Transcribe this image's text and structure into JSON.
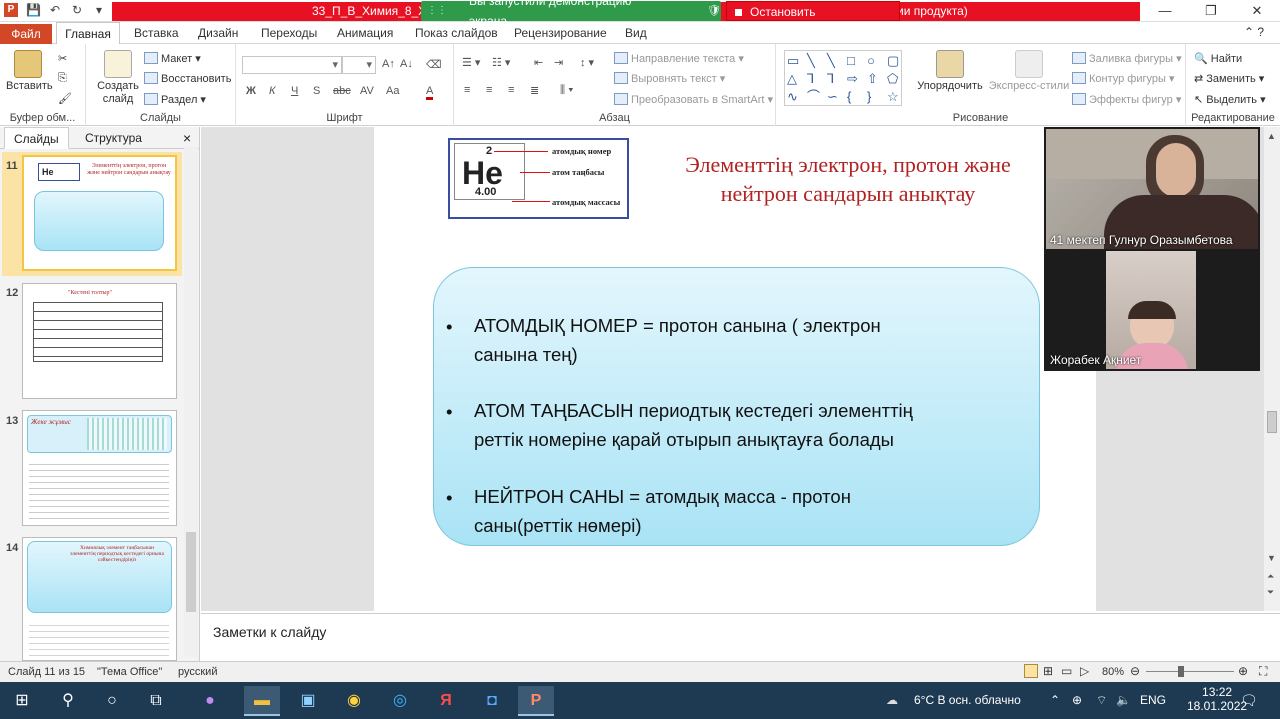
{
  "window": {
    "title_prefix": "33_П_В_Химия_8_Хим",
    "title_suffix": "ии продукта)",
    "controls": [
      "—",
      "❐",
      "✕"
    ]
  },
  "share_bar": {
    "message": "Вы запустили демонстрацию экрана",
    "stop_label": "Остановить демонстрацию",
    "colors": {
      "green": "#2e9a4a",
      "red": "#e81123"
    }
  },
  "ribbon_tabs": [
    "Файл",
    "Главная",
    "Вставка",
    "Дизайн",
    "Переходы",
    "Анимация",
    "Показ слайдов",
    "Рецензирование",
    "Вид"
  ],
  "ribbon": {
    "clipboard": {
      "paste": "Вставить",
      "label": "Буфер обм..."
    },
    "slides": {
      "new_slide_1": "Создать",
      "new_slide_2": "слайд",
      "layout": "Макет",
      "reset": "Восстановить",
      "section": "Раздел",
      "label": "Слайды"
    },
    "font": {
      "label": "Шрифт",
      "bold": "Ж",
      "italic": "К",
      "underline": "Ч",
      "strike": "S",
      "abc": "abc",
      "av": "AV",
      "aa": "Aa",
      "a": "A"
    },
    "paragraph": {
      "text_direction": "Направление текста",
      "align_text": "Выровнять текст",
      "smartart": "Преобразовать в SmartArt",
      "label": "Абзац"
    },
    "drawing": {
      "arrange": "Упорядочить",
      "quick_styles": "Экспресс-стили",
      "fill": "Заливка фигуры",
      "outline": "Контур фигуры",
      "effects": "Эффекты фигур",
      "label": "Рисование"
    },
    "editing": {
      "find": "Найти",
      "replace": "Заменить",
      "select": "Выделить",
      "label": "Редактирование"
    }
  },
  "left_panel": {
    "tabs": [
      "Слайды",
      "Структура"
    ],
    "close": "×",
    "slides": [
      {
        "num": "11",
        "title": "Элементтің электрон, протон және нейтрон сандарын анықтау"
      },
      {
        "num": "12",
        "title": "\"Кестені толтыр\""
      },
      {
        "num": "13",
        "title": "Жеке жұмыс"
      },
      {
        "num": "14",
        "title": "Химиялық элемент таңбасынан элементтің периодтық кестедегі орнына сәйкестендіріңіз"
      }
    ]
  },
  "slide": {
    "he_card": {
      "number": "2",
      "symbol": "He",
      "mass": "4.00",
      "label_number": "атомдық номер",
      "label_symbol": "атом таңбасы",
      "label_mass": "атомдық массасы"
    },
    "title_line1": "Элементтің электрон, протон және",
    "title_line2": "нейтрон сандарын анықтау",
    "bullets": [
      {
        "mark": "•",
        "line1": "АТОМДЫҚ НОМЕР = протон санына ( электрон",
        "line2": "санына тең)"
      },
      {
        "mark": "•",
        "line1": "АТОМ ТАҢБАСЫН периодтық кестедегі элементтің",
        "line2": "реттік номеріне қарай отырып анықтауға болады"
      },
      {
        "mark": "•",
        "line1": "НЕЙТРОН САНЫ = атомдық масса - протон",
        "line2": "саны(реттік нөмері)"
      }
    ]
  },
  "video": {
    "participant1": "41 мектеп Гулнур Оразымбетова",
    "participant2": "Жорабек Ақниет"
  },
  "notes": {
    "placeholder": "Заметки к слайду"
  },
  "status": {
    "slide_of": "Слайд 11 из 15",
    "theme": "\"Тема Office\"",
    "language": "русский",
    "zoom": "80%"
  },
  "taskbar": {
    "weather": "6°C  В осн. облачно",
    "lang": "ENG",
    "time": "13:22",
    "date": "18.01.2022"
  }
}
